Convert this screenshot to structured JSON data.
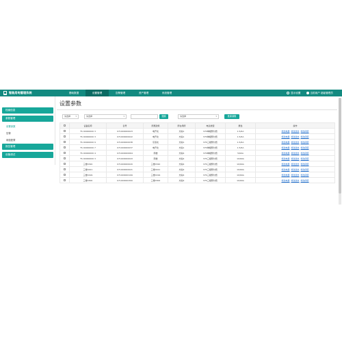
{
  "app": {
    "title": "智能用电管理系统"
  },
  "nav": {
    "items": [
      "基础数据",
      "设置管理",
      "告警管理",
      "资产管理",
      "系统管理"
    ],
    "active_index": 1
  },
  "topright": {
    "settings_label": "显示设置",
    "user_label": "当前用户 超级管理员"
  },
  "sidebar": {
    "groups": [
      "档案信息",
      "参数管理",
      "报告管理",
      "设备调试"
    ],
    "subitems": [
      "设置参数",
      "告警",
      "阈值配置"
    ],
    "active_sub": "设置参数"
  },
  "page": {
    "title": "设置参数"
  },
  "filters": {
    "select1": "请选择",
    "select2": "请选择",
    "input_value": "",
    "query_label": "搜索",
    "select3": "请选择",
    "batch_label": "批量读取"
  },
  "table": {
    "headers": [
      "",
      "设备名称",
      "表号",
      "所属建筑",
      "所在场所",
      "电表类型",
      "属性",
      "操作"
    ],
    "rows": [
      [
        "TS 00000000 3",
        "071000000023",
        "电开北",
        "方案1",
        "STS单相预付费",
        "1.5/6A"
      ],
      [
        "TS 00000000 3",
        "071000000022",
        "电开北",
        "方案1",
        "STS单相预付费",
        "1.5/6A"
      ],
      [
        "TS 00000000 9",
        "071000000038",
        "东馆北",
        "方案1",
        "STS三相预付费",
        "1.5/6A"
      ],
      [
        "TS 00000000 7",
        "071000000037",
        "电开北",
        "方案1",
        "STS单相预付费",
        "1.5/6A"
      ],
      [
        "TS 00000000 4",
        "071000000064",
        "南楼",
        "方案4",
        "STS单相预付费",
        "5/60A"
      ],
      [
        "TS 00000000 3",
        "071000000043",
        "南楼",
        "方案4",
        "STS三相预付费",
        "10/60A"
      ],
      [
        "三楼0320",
        "071000000020",
        "三楼0320",
        "方案4",
        "STS三相预付费",
        "10/60A"
      ],
      [
        "三楼0421",
        "071000000021",
        "三楼0421",
        "方案4",
        "STS三相预付费",
        "10/60A"
      ],
      [
        "三楼0199",
        "071000000199",
        "三楼0199",
        "方案4",
        "STS三相预付费",
        "10/60A"
      ],
      [
        "三楼0300",
        "071000000300",
        "三楼0300",
        "方案4",
        "STS三相预付费",
        "10/60A"
      ]
    ],
    "actions": [
      "修改电量",
      "修改透支",
      "修改阈值"
    ]
  },
  "icons": {
    "brand": "building-icon",
    "settings": "gear-icon",
    "user": "user-icon"
  },
  "colors": {
    "topbar": "#138a80",
    "accent": "#17a79a",
    "link": "#1e6fd0"
  }
}
